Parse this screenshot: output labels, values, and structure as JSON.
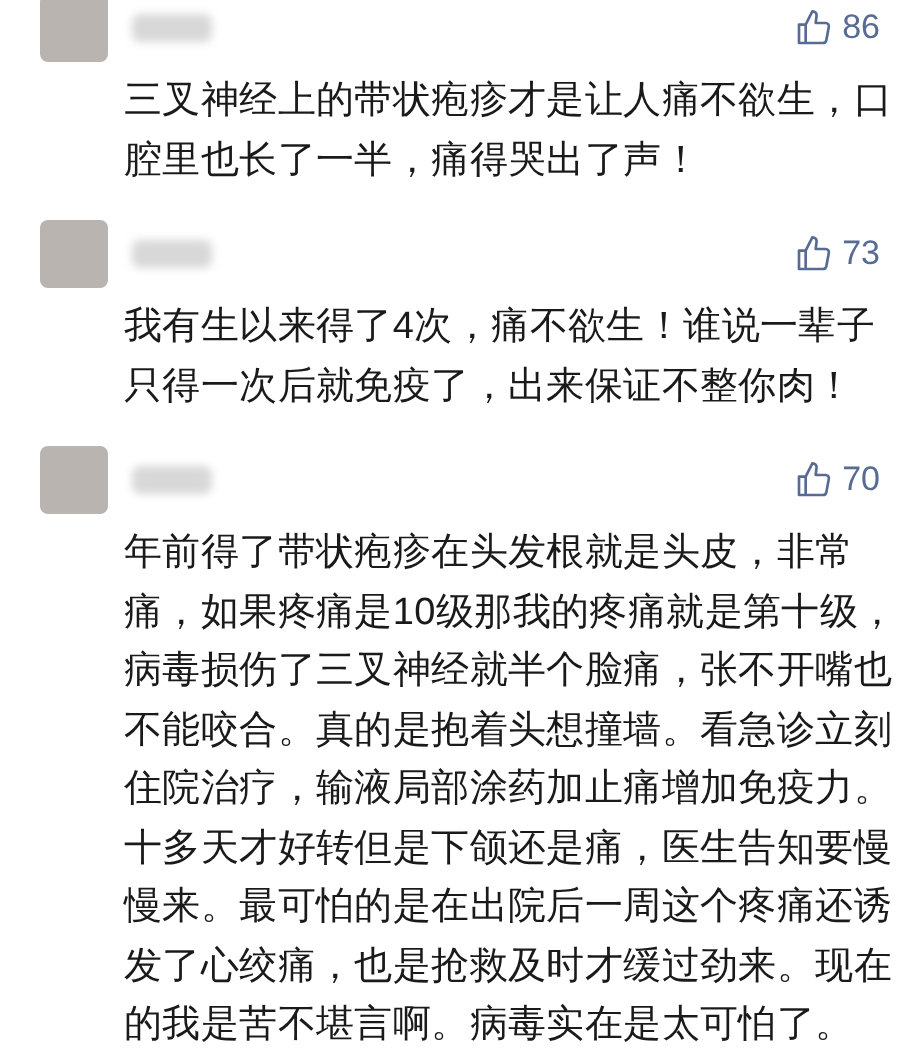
{
  "comments": [
    {
      "likes": "86",
      "text": "三叉神经上的带状疱疹才是让人痛不欲生，口腔里也长了一半，痛得哭出了声！"
    },
    {
      "likes": "73",
      "text": "我有生以来得了4次，痛不欲生！谁说一辈子只得一次后就免疫了，出来保证不整你肉！"
    },
    {
      "likes": "70",
      "text": "年前得了带状疱疹在头发根就是头皮，非常痛，如果疼痛是10级那我的疼痛就是第十级，病毒损伤了三叉神经就半个脸痛，张不开嘴也不能咬合。真的是抱着头想撞墙。看急诊立刻住院治疗，输液局部涂药加止痛增加免疫力。十多天才好转但是下颌还是痛，医生告知要慢慢来。最可怕的是在出院后一周这个疼痛还诱发了心绞痛，也是抢救及时才缓过劲来。现在的我是苦不堪言啊。病毒实在是太可怕了。"
    }
  ]
}
